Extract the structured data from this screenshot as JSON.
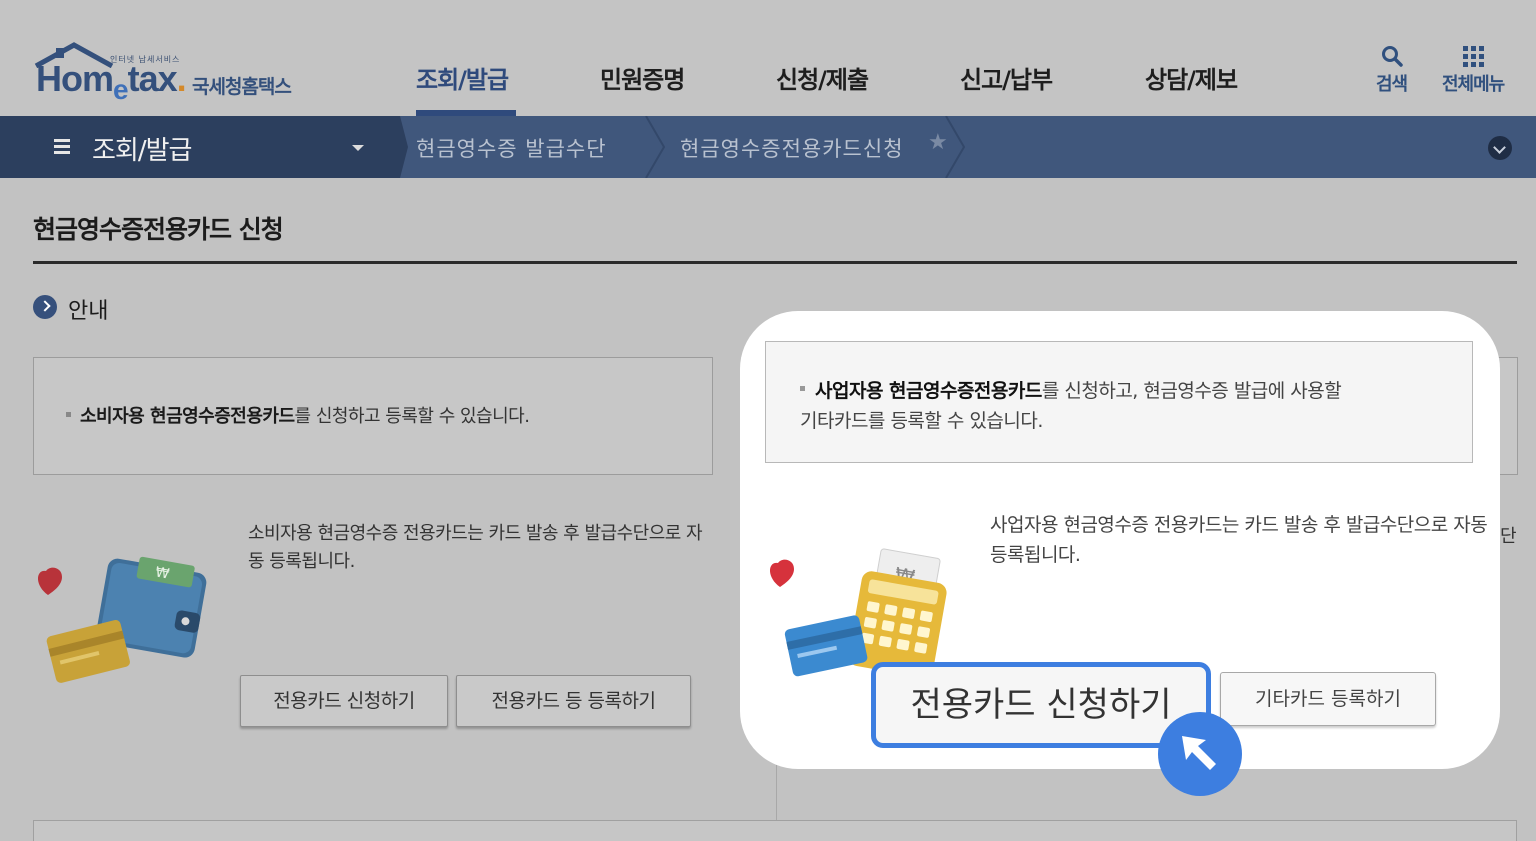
{
  "header": {
    "logo": {
      "small_text": "인터넷 납세서비스",
      "main_text_1": "Hom",
      "main_text_e": "e",
      "main_text_2": "tax",
      "dot": ".",
      "kor_text": "국세청홈택스"
    },
    "nav": [
      {
        "label": "조회/발급"
      },
      {
        "label": "민원증명"
      },
      {
        "label": "신청/제출"
      },
      {
        "label": "신고/납부"
      },
      {
        "label": "상담/제보"
      }
    ],
    "search_label": "검색",
    "all_menu_label": "전체메뉴"
  },
  "breadcrumb": {
    "section": "조회/발급",
    "items": [
      "현금영수증 발급수단",
      "현금영수증전용카드신청"
    ],
    "star": "★"
  },
  "page": {
    "title": "현금영수증전용카드 신청",
    "guide_label": "안내"
  },
  "consumer": {
    "info_bold": "소비자용 현금영수증전용카드",
    "info_rest": "를 신청하고 등록할 수 있습니다.",
    "desc": "소비자용 현금영수증 전용카드는 카드 발송 후 발급수단으로 자동 등록됩니다.",
    "btn_apply": "전용카드 신청하기",
    "btn_register": "전용카드 등 등록하기"
  },
  "business": {
    "info_bold": "사업자용 현금영수증전용카드",
    "info_rest_1": "를 신청하고, 현금영수증 발급에 사용할",
    "info_rest_2": "기타카드를 등록할 수 있습니다.",
    "desc": "사업자용 현금영수증 전용카드는 카드 발송 후 발급수단으로 자동 등록됩니다.",
    "btn_apply": "전용카드 신청하기",
    "btn_register": "기타카드 등록하기",
    "hidden_edge_text": "단"
  },
  "colors": {
    "brand_navy": "#2f4a7c",
    "highlight_blue": "#3d7ee0",
    "dim_background": "#c2c2c2"
  },
  "icons": [
    "home-roof-icon",
    "search-icon",
    "grid-menu-icon",
    "hamburger-icon",
    "caret-down-icon",
    "star-icon",
    "chevron-down-icon",
    "arrow-right-circle-icon",
    "wallet-illustration",
    "calculator-illustration",
    "heart-icon",
    "cursor-arrow-icon"
  ]
}
